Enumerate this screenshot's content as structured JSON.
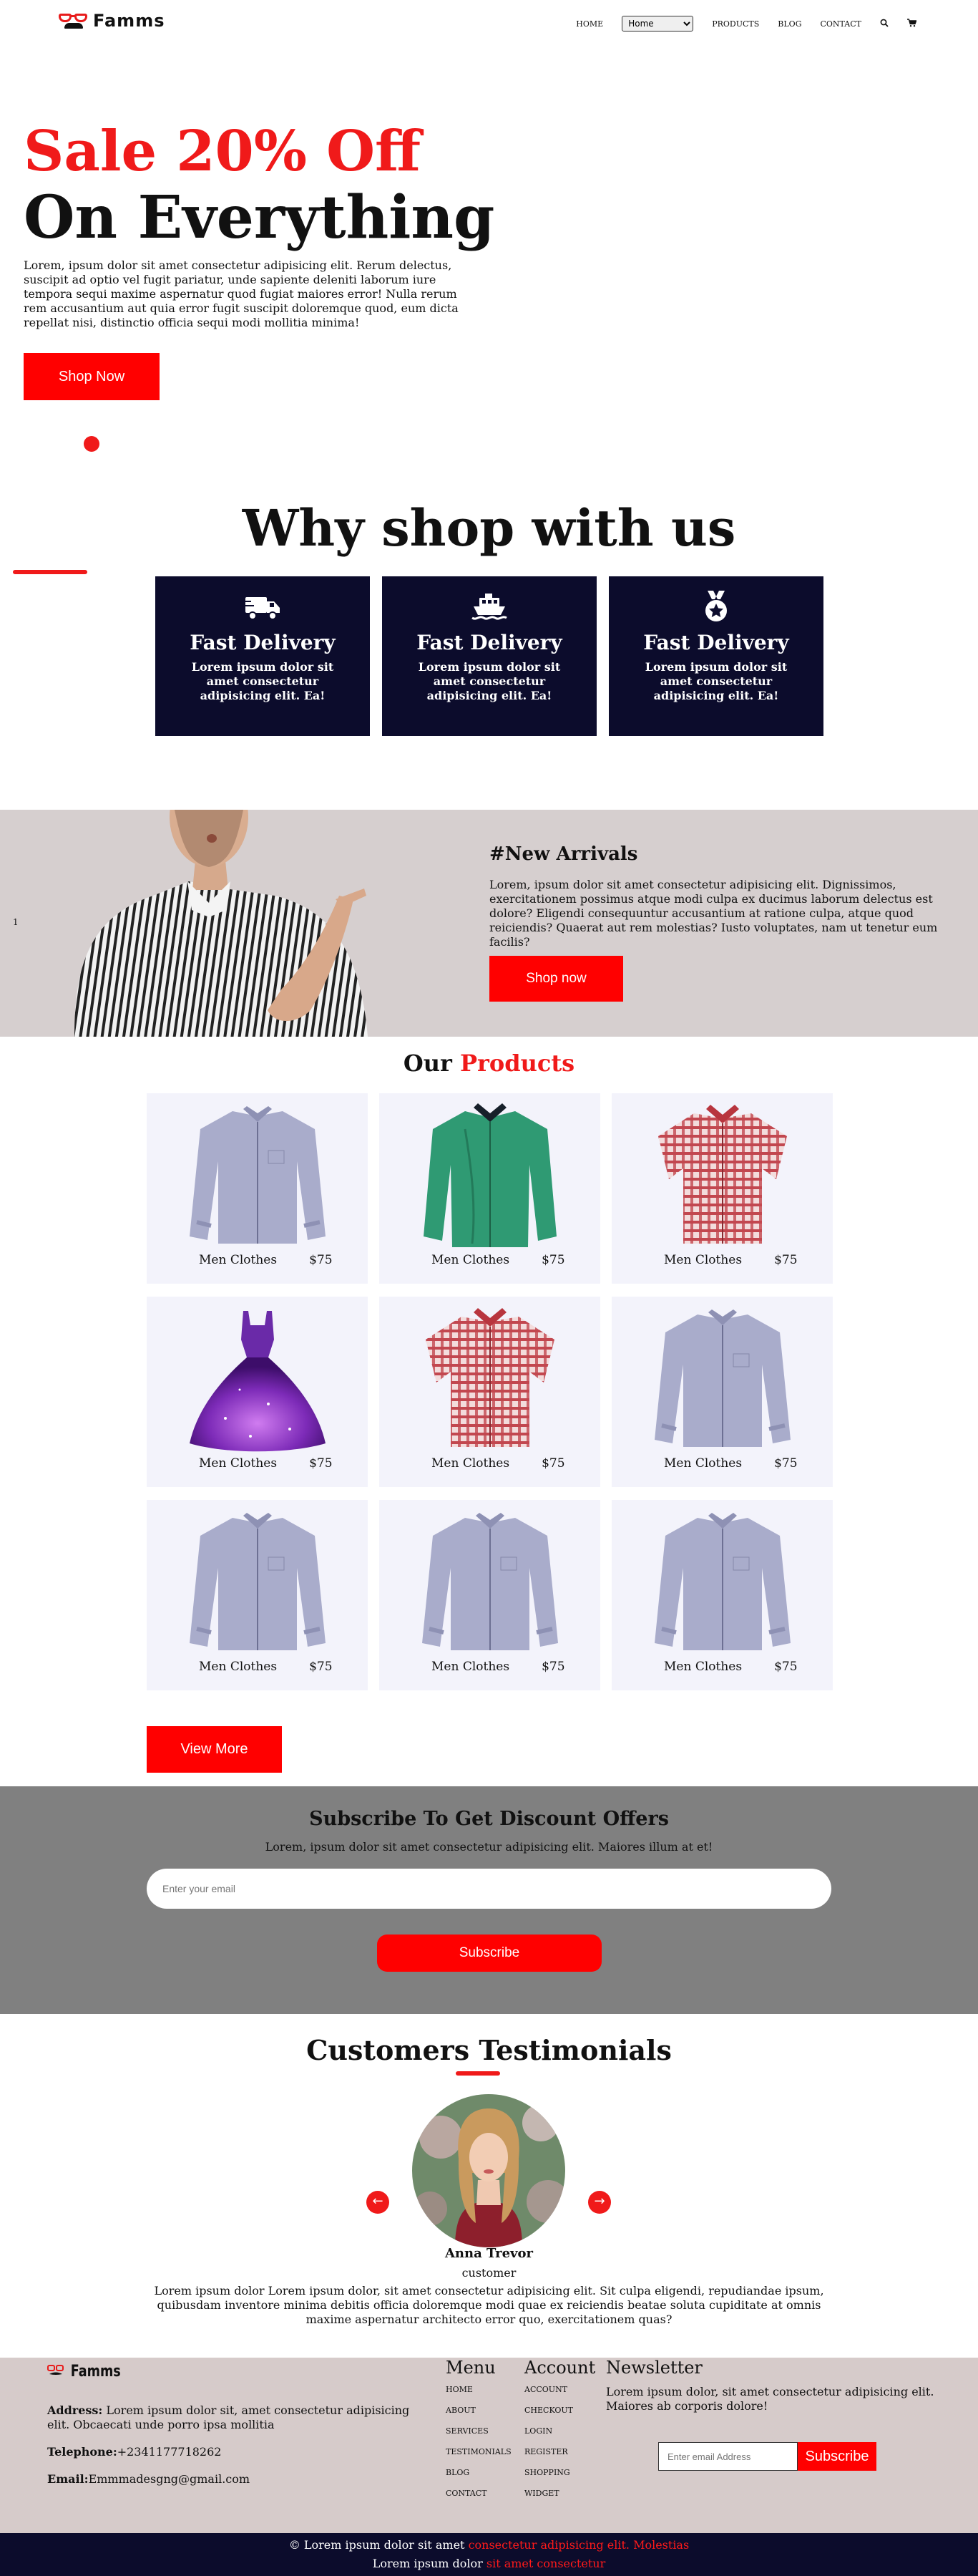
{
  "nav": {
    "logo_text": "Famms",
    "links": [
      "HOME",
      "PRODUCTS",
      "BLOG",
      "CONTACT"
    ],
    "select_value": "Home",
    "search_icon": "search-icon",
    "cart_icon": "cart-icon"
  },
  "hero": {
    "title_red": "Sale 20% Off",
    "title_black": "On Everything",
    "text": "Lorem, ipsum dolor sit amet consectetur adipisicing elit. Rerum delectus, suscipit ad optio vel fugit pariatur, unde sapiente deleniti laborum iure tempora sequi maxime aspernatur quod fugiat maiores error! Nulla rerum rem accusantium aut quia error fugit suscipit doloremque quod, eum dicta repellat nisi, distinctio officia sequi modi mollitia minima!",
    "button": "Shop Now"
  },
  "why": {
    "title": "Why shop with us",
    "cards": [
      {
        "icon": "truck-icon",
        "title": "Fast Delivery",
        "text": "Lorem ipsum dolor sit amet consectetur adipisicing elit. Ea!"
      },
      {
        "icon": "ship-icon",
        "title": "Fast Delivery",
        "text": "Lorem ipsum dolor sit amet consectetur adipisicing elit. Ea!"
      },
      {
        "icon": "medal-icon",
        "title": "Fast Delivery",
        "text": "Lorem ipsum dolor sit amet consectetur adipisicing elit. Ea!"
      }
    ]
  },
  "arrivals": {
    "slide_number": "1",
    "title": "#New Arrivals",
    "text": "Lorem, ipsum dolor sit amet consectetur adipisicing elit. Dignissimos, exercitationem possimus atque modi culpa ex ducimus laborum delectus est dolore? Eligendi consequuntur accusantium at ratione culpa, atque quod reiciendis? Quaerat aut rem molestias? Iusto voluptates, nam ut tenetur eum facilis?",
    "button": "Shop now"
  },
  "products": {
    "title_black": "Our ",
    "title_red": "Products",
    "items": [
      {
        "name": "Men Clothes",
        "price": "$75",
        "image": "blue-shirt"
      },
      {
        "name": "Men Clothes",
        "price": "$75",
        "image": "green-shirt"
      },
      {
        "name": "Men Clothes",
        "price": "$75",
        "image": "red-check-shirt"
      },
      {
        "name": "Men Clothes",
        "price": "$75",
        "image": "purple-dress"
      },
      {
        "name": "Men Clothes",
        "price": "$75",
        "image": "red-check-shirt"
      },
      {
        "name": "Men Clothes",
        "price": "$75",
        "image": "blue-shirt"
      },
      {
        "name": "Men Clothes",
        "price": "$75",
        "image": "blue-shirt"
      },
      {
        "name": "Men Clothes",
        "price": "$75",
        "image": "blue-shirt"
      },
      {
        "name": "Men Clothes",
        "price": "$75",
        "image": "blue-shirt"
      }
    ],
    "view_more": "View More"
  },
  "subscribe": {
    "title": "Subscribe To Get Discount Offers",
    "text": "Lorem, ipsum dolor sit amet consectetur adipisicing elit. Maiores illum at et!",
    "placeholder": "Enter your email",
    "button": "Subscribe"
  },
  "testimonials": {
    "title": "Customers Testimonials",
    "name": "Anna Trevor",
    "role": "customer",
    "quote": "Lorem ipsum dolor Lorem ipsum dolor, sit amet consectetur adipisicing elit. Sit culpa eligendi, repudiandae ipsum, quibusdam inventore minima debitis officia doloremque modi quae ex reiciendis beatae soluta cupiditate at omnis maxime aspernatur architecto error quo, exercitationem quas?",
    "prev_icon": "arrow-left-icon",
    "next_icon": "arrow-right-icon"
  },
  "footer": {
    "logo_text": "Famms",
    "address_label": "Address:",
    "address": " Lorem ipsum dolor sit, amet consectetur adipisicing elit. Obcaecati unde porro ipsa mollitia",
    "phone_label": "Telephone:",
    "phone": "+2341177718262",
    "email_label": "Email:",
    "email": "Emmmadesgng@gmail.com",
    "menu_title": "Menu",
    "menu_items": [
      "HOME",
      "ABOUT",
      "SERVICES",
      "TESTIMONIALS",
      "BLOG",
      "CONTACT"
    ],
    "account_title": "Account",
    "account_items": [
      "ACCOUNT",
      "CHECKOUT",
      "LOGIN",
      "REGISTER",
      "SHOPPING",
      "WIDGET"
    ],
    "newsletter_title": "Newsletter",
    "newsletter_text": "Lorem ipsum dolor, sit amet consectetur adipisicing elit. Maiores ab corporis dolore!",
    "newsletter_placeholder": "Enter email Address",
    "newsletter_button": "Subscribe"
  },
  "bottom": {
    "line1_white": "© Lorem ipsum dolor sit amet ",
    "line1_red": "consectetur adipisicing elit. Molestias",
    "line2_white": "Lorem ipsum dolor ",
    "line2_red": "sit amet consectetur"
  },
  "colors": {
    "accent": "#f01a1a",
    "navy": "#0c0c2c",
    "arrivals_bg": "#d6cfcf",
    "subscribe_bg": "#808080"
  }
}
